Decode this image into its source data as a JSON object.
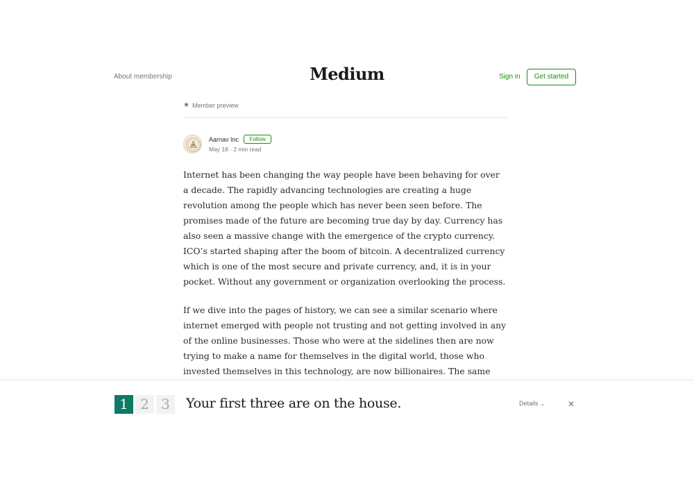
{
  "header": {
    "about_label": "About membership",
    "logo": "Medium",
    "signin_label": "Sign in",
    "get_started_label": "Get started"
  },
  "preview": {
    "label": "Member preview",
    "icon": "star-icon"
  },
  "author": {
    "name": "Aarnav Inc",
    "follow_label": "Follow",
    "date": "May 18",
    "read_time": "2 min read",
    "meta": "May 18 · 2 min read"
  },
  "article": {
    "paragraphs": [
      "Internet has been changing the way people have been behaving for over a decade. The rapidly advancing technologies are creating a huge revolution among the people which has never been seen before. The promises made of the future are becoming true day by day. Currency has also seen a massive change with the emergence of the crypto currency. ICO’s started shaping after the boom of bitcoin. A decentralized currency which is one of the most secure and private currency, and, it is in your pocket. Without any government or organization overlooking the process.",
      "If we dive into the pages of history, we can see a similar scenario where internet emerged with people not trusting and not getting involved in any of the online businesses. Those who were at the sidelines then are now trying to make a name for themselves in the digital world, those who invested themselves in this technology, are now billionaires. The same scenarios can be"
    ]
  },
  "paywall": {
    "counts": [
      "1",
      "2",
      "3"
    ],
    "title": "Your first three are on the house.",
    "details_label": "Details",
    "close_symbol": "✕"
  },
  "colors": {
    "accent_green": "#1a8917",
    "counter_green": "#0f7a65"
  }
}
